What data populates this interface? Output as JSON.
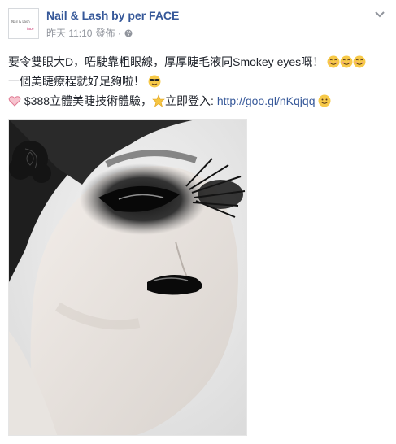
{
  "post": {
    "page_name": "Nail & Lash by per FACE",
    "avatar_text_1": "Nail & Lash",
    "avatar_text_2": "face",
    "time": "昨天 11:10",
    "privacy": "發佈 ·",
    "line1": "要令雙眼大D，唔駛靠粗眼線，厚厚睫毛液同Smokey eyes嘅！",
    "line2": "一個美睫療程就好足夠啦！",
    "line3_text": " $388立體美睫技術體驗，",
    "line3_cta": "立即登入: ",
    "link": "http://goo.gl/nKqjqq"
  },
  "icons": {
    "privacy": "globe-icon",
    "menu": "chevron-down-icon",
    "emoji_line1": "smiling-face-icon",
    "emoji_line2": "sunglasses-face-icon",
    "emoji_line3a": "heart-icon",
    "emoji_line3b": "star-icon",
    "emoji_line3c": "smiley-icon"
  },
  "colors": {
    "name": "#365899",
    "meta": "#90949c",
    "text": "#1d2129",
    "link": "#365899"
  }
}
